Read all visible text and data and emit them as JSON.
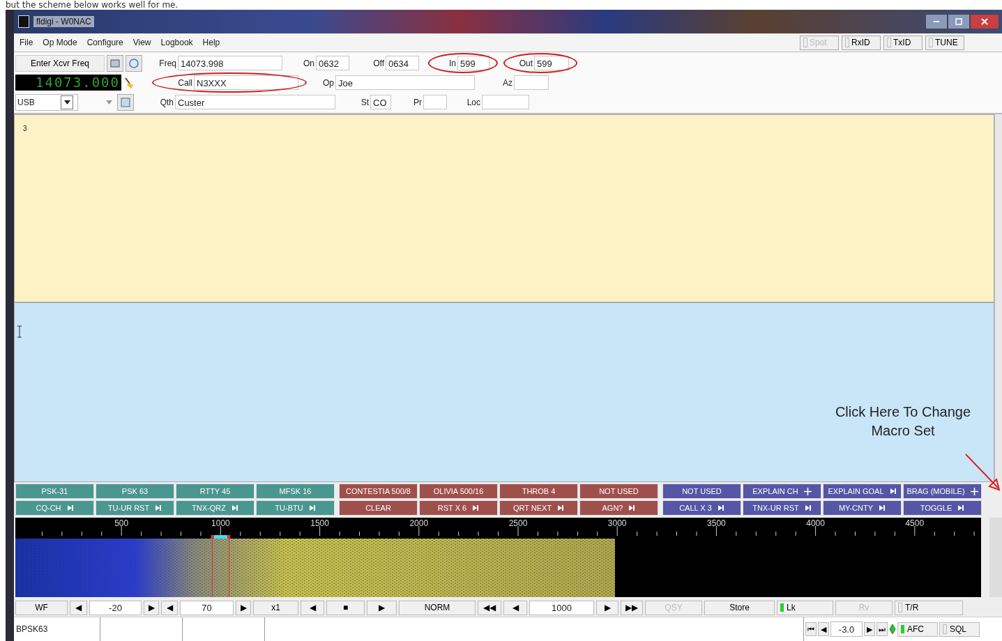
{
  "caption": "but the scheme below works well for me.",
  "window": {
    "title": "fldigi - W0NAC"
  },
  "menu": [
    "File",
    "Op Mode",
    "Configure",
    "View",
    "Logbook",
    "Help"
  ],
  "toggles": [
    {
      "label": "Spot",
      "disabled": true,
      "checked": false
    },
    {
      "label": "RxID",
      "disabled": false,
      "checked": false
    },
    {
      "label": "TxID",
      "disabled": false,
      "checked": false
    },
    {
      "label": "TUNE",
      "disabled": false,
      "checked": false
    }
  ],
  "rig": {
    "enter_freq_button": "Enter Xcvr Freq",
    "freq_display": "14073.000",
    "mode": "USB"
  },
  "log_rows": [
    [
      {
        "label": "Freq",
        "value": "14073.998",
        "highlighted": false
      },
      {
        "label": "On",
        "value": "0632",
        "highlighted": false
      },
      {
        "label": "Off",
        "value": "0634",
        "highlighted": false
      },
      {
        "label": "In",
        "value": "599",
        "highlighted": true
      },
      {
        "label": "Out",
        "value": "599",
        "highlighted": true
      }
    ],
    [
      {
        "label": "Call",
        "value": "N3XXX",
        "highlighted": true
      },
      {
        "label": "Op",
        "value": "Joe",
        "highlighted": false
      },
      {
        "label": "Az",
        "highlighted": false
      }
    ],
    [
      {
        "label": "Qth",
        "value": "Custer",
        "highlighted": false
      },
      {
        "label": "St",
        "value": "CO",
        "highlighted": false
      },
      {
        "label": "Pr",
        "highlighted": false
      },
      {
        "label": "Loc",
        "highlighted": false
      }
    ]
  ],
  "rx_text": "3",
  "annotation": {
    "text": "Click Here To Change Macro Set"
  },
  "macros": [
    [
      {
        "label": "PSK-31",
        "kind": "plain",
        "color": "#4a9690"
      },
      {
        "label": "PSK 63",
        "kind": "plain",
        "color": "#4a9690"
      },
      {
        "label": "RTTY 45",
        "kind": "plain",
        "color": "#4a9690"
      },
      {
        "label": "MFSK 16",
        "kind": "plain",
        "color": "#4a9690"
      },
      {
        "label": "CONTESTIA 500/8",
        "kind": "plain",
        "color": "#a0504c"
      },
      {
        "label": "OLIVIA 500/16",
        "kind": "plain",
        "color": "#a0504c"
      },
      {
        "label": "THROB 4",
        "kind": "plain",
        "color": "#a0504c"
      },
      {
        "label": "NOT USED",
        "kind": "plain",
        "color": "#a0504c"
      },
      {
        "label": "NOT USED",
        "kind": "plain",
        "color": "#5556a6"
      },
      {
        "label": "EXPLAIN CH",
        "kind": "plus",
        "color": "#5556a6"
      },
      {
        "label": "EXPLAIN GOAL",
        "kind": "skip",
        "color": "#5556a6"
      },
      {
        "label": "BRAG (MOBILE)",
        "kind": "plus",
        "color": "#5556a6"
      }
    ],
    [
      {
        "label": "CQ-CH",
        "kind": "skip",
        "color": "#4a9690"
      },
      {
        "label": "TU-UR RST",
        "kind": "skip",
        "color": "#4a9690"
      },
      {
        "label": "TNX-QRZ",
        "kind": "skip",
        "color": "#4a9690"
      },
      {
        "label": "TU-BTU",
        "kind": "skip",
        "color": "#4a9690"
      },
      {
        "label": "CLEAR",
        "kind": "plain",
        "color": "#a0504c"
      },
      {
        "label": "RST X 6",
        "kind": "skip",
        "color": "#a0504c"
      },
      {
        "label": "QRT NEXT",
        "kind": "skip",
        "color": "#a0504c"
      },
      {
        "label": "AGN?",
        "kind": "skip",
        "color": "#a0504c"
      },
      {
        "label": "CALL X 3",
        "kind": "skip",
        "color": "#5556a6"
      },
      {
        "label": "TNX-UR RST",
        "kind": "skip",
        "color": "#5556a6"
      },
      {
        "label": "MY-CNTY",
        "kind": "skip",
        "color": "#5556a6"
      },
      {
        "label": "TOGGLE",
        "kind": "skip",
        "color": "#5556a6"
      }
    ]
  ],
  "scale": [
    "500",
    "1000",
    "1500",
    "2000",
    "2500",
    "3000",
    "3500",
    "4000",
    "4500"
  ],
  "controls": [
    {
      "kind": "button",
      "label": "WF",
      "disabled": false
    },
    {
      "kind": "button",
      "label": "◀",
      "disabled": false
    },
    {
      "kind": "value",
      "label": "-20"
    },
    {
      "kind": "button",
      "label": "▶",
      "disabled": false
    },
    {
      "kind": "button",
      "label": "◀",
      "disabled": false
    },
    {
      "kind": "value",
      "label": "70"
    },
    {
      "kind": "button",
      "label": "▶",
      "disabled": false
    },
    {
      "kind": "button",
      "label": "x1",
      "disabled": false
    },
    {
      "kind": "button",
      "label": "◀",
      "disabled": false
    },
    {
      "kind": "button",
      "label": "■",
      "disabled": false
    },
    {
      "kind": "button",
      "label": "▶",
      "disabled": false
    },
    {
      "kind": "button",
      "label": "NORM",
      "disabled": false
    },
    {
      "kind": "button",
      "label": "◀◀",
      "disabled": false
    },
    {
      "kind": "button",
      "label": "◀",
      "disabled": false
    },
    {
      "kind": "value",
      "label": "1000"
    },
    {
      "kind": "button",
      "label": "▶",
      "disabled": false
    },
    {
      "kind": "button",
      "label": "▶▶",
      "disabled": false
    },
    {
      "kind": "button",
      "label": "QSY",
      "disabled": true
    },
    {
      "kind": "button",
      "label": "Store",
      "disabled": false
    },
    {
      "kind": "lamp",
      "label": "Lk",
      "on": true,
      "disabled": false
    },
    {
      "kind": "button",
      "label": "Rv",
      "disabled": true
    },
    {
      "kind": "check",
      "label": "T/R",
      "on": false,
      "disabled": false
    }
  ],
  "status": {
    "mode": "BPSK63",
    "s2n_buttons": [
      "⏮",
      "◀"
    ],
    "s2n": "-3.0",
    "s2n_buttons_after": [
      "▶",
      "⏭"
    ],
    "afc": {
      "label": "AFC",
      "on": true
    },
    "sql": {
      "label": "SQL",
      "on": false
    }
  }
}
